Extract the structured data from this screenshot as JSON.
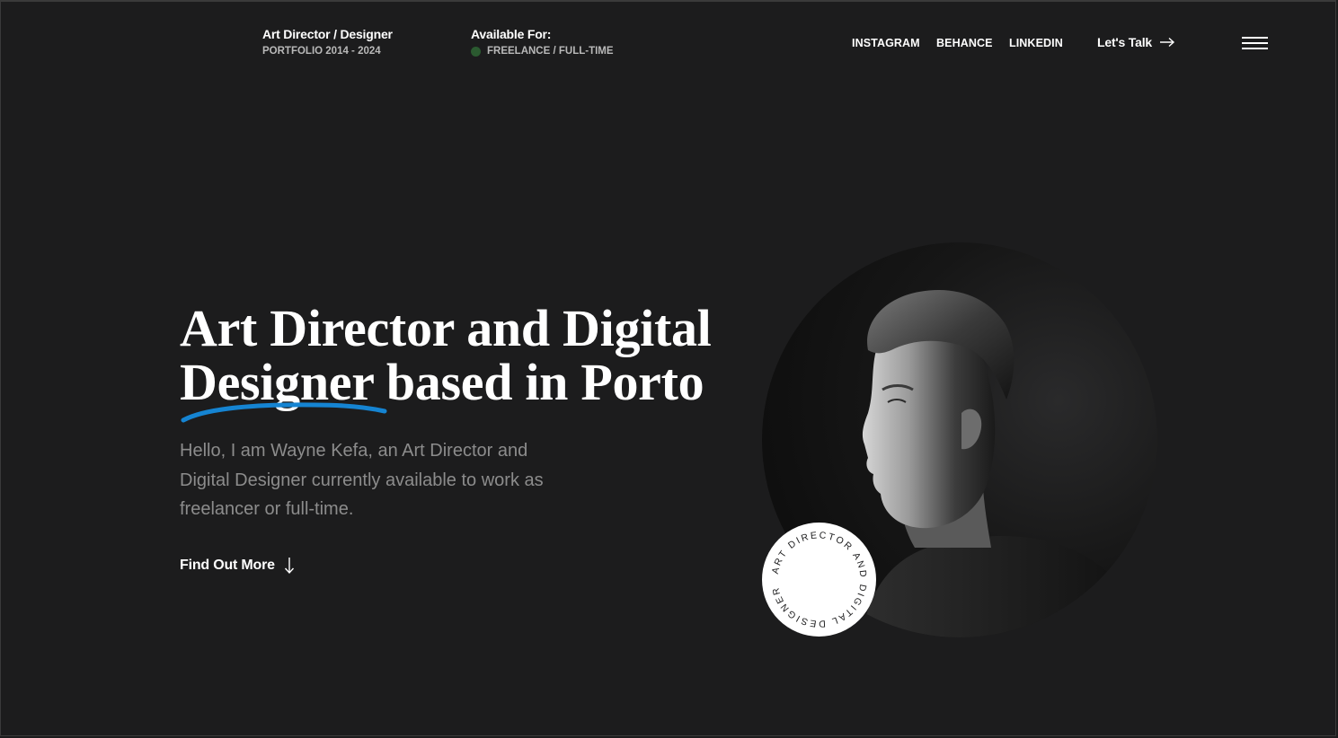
{
  "header": {
    "brand": {
      "role": "Art Director / Designer",
      "portfolio": "PORTFOLIO 2014 - 2024"
    },
    "availability": {
      "label": "Available For:",
      "value": "FREELANCE / FULL-TIME",
      "status_color": "#2b5a30"
    },
    "social_links": [
      {
        "label": "INSTAGRAM"
      },
      {
        "label": "BEHANCE"
      },
      {
        "label": "LINKEDIN"
      }
    ],
    "cta": {
      "label": "Let's Talk",
      "icon": "arrow-right-icon"
    },
    "menu_icon": "hamburger-menu-icon"
  },
  "hero": {
    "title_line1": "Art Director and Digital",
    "title_line2_highlight": "Designer",
    "title_line2_rest": " based in Porto",
    "intro": "Hello, I am Wayne Kefa, an Art Director and Digital Designer currently available to work as freelancer or full-time.",
    "cta": {
      "label": "Find Out More",
      "icon": "arrow-down-icon"
    },
    "underline_color": "#1584d2"
  },
  "portrait": {
    "badge_text": "ART DIRECTOR AND DIGITAL DESIGNER"
  },
  "colors": {
    "background": "#1c1c1d",
    "text_primary": "#ffffff",
    "text_muted": "#8c8c8c",
    "text_secondary": "#b9b9b9",
    "accent": "#1584d2"
  }
}
